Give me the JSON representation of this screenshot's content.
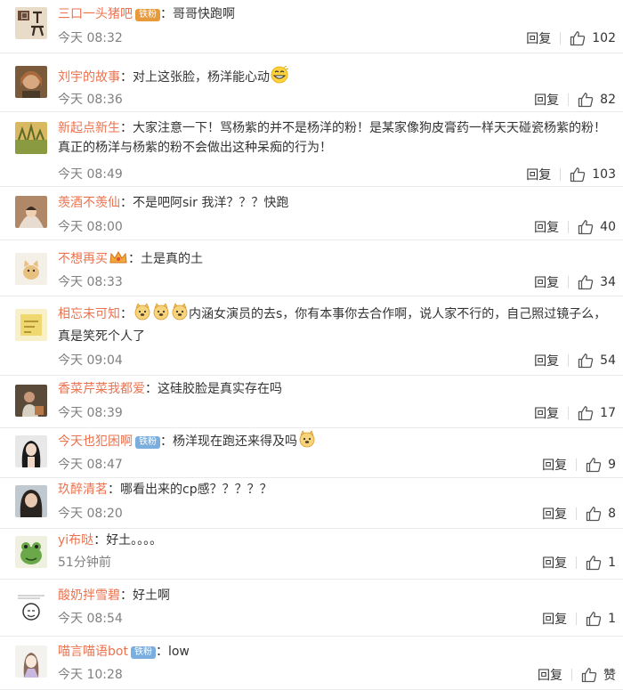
{
  "comments": [
    {
      "username": "三口一头猪吧",
      "badge": {
        "type": "fans",
        "label": "铁粉"
      },
      "text": "哥哥快跑啊",
      "time": "今天 08:32",
      "reply": "回复",
      "likes": "102",
      "avatar": "avatar-calligraphy"
    },
    {
      "username": "刘宇的故事",
      "text": "对上这张脸，杨洋能心动",
      "emojis_after": [
        "grin-emoji"
      ],
      "time": "今天 08:36",
      "reply": "回复",
      "likes": "82",
      "avatar": "avatar-portrait"
    },
    {
      "username": "新起点新生",
      "text": "大家注意一下！骂杨紫的并不是杨洋的粉！是某家像狗皮膏药一样天天碰瓷杨紫的粉！真正的杨洋与杨紫的粉不会做出这种呆痴的行为！",
      "time": "今天 08:49",
      "reply": "回复",
      "likes": "103",
      "avatar": "avatar-field"
    },
    {
      "username": "羡酒不羡仙",
      "text": "不是吧阿sir 我洋？？？快跑",
      "time": "今天 08:00",
      "reply": "回复",
      "likes": "40",
      "avatar": "avatar-blanket"
    },
    {
      "username": "不想再买",
      "badge": {
        "type": "crown"
      },
      "text": "土是真的土",
      "time": "今天 08:33",
      "reply": "回复",
      "likes": "34",
      "avatar": "avatar-cat"
    },
    {
      "username": "相忘未可知",
      "emojis_before": [
        "doge-emoji",
        "doge-emoji",
        "doge-emoji"
      ],
      "text": "内涵女演员的去s，你有本事你去合作啊，说人家不行的，自己照过镜子么，真是笑死个人了",
      "time": "今天 09:04",
      "reply": "回复",
      "likes": "54",
      "avatar": "avatar-yellow"
    },
    {
      "username": "香菜芹菜我都爱",
      "text": "这硅胶脸是真实存在吗",
      "time": "今天 08:39",
      "reply": "回复",
      "likes": "17",
      "avatar": "avatar-person"
    },
    {
      "username": "今天也犯困啊",
      "badge": {
        "type": "iron",
        "label": "铁粉"
      },
      "text": "杨洋现在跑还来得及吗",
      "emojis_after": [
        "doge-emoji"
      ],
      "time": "今天 08:47",
      "reply": "回复",
      "likes": "9",
      "avatar": "avatar-woman"
    },
    {
      "username": "玖醉清茗",
      "text": "哪看出来的cp感？？？？？",
      "time": "今天 08:20",
      "reply": "回复",
      "likes": "8",
      "avatar": "avatar-girl"
    },
    {
      "username": "yi布哒",
      "text": "好土。。。。",
      "time": "51分钟前",
      "reply": "回复",
      "likes": "1",
      "avatar": "avatar-frog"
    },
    {
      "username": "酸奶拌雪碧",
      "text": "好土啊",
      "time": "今天 08:54",
      "reply": "回复",
      "likes": "1",
      "avatar": "avatar-meme"
    },
    {
      "username": "喵言喵语bot",
      "badge": {
        "type": "iron",
        "label": "铁粉"
      },
      "text": "low",
      "time": "今天 10:28",
      "reply": "回复",
      "likes": "赞",
      "avatar": "avatar-drawing"
    }
  ],
  "colors": {
    "username": "#eb7350",
    "text": "#333333",
    "meta": "#808080",
    "divider": "#eaeaea",
    "badge_fans": "#e79a3a",
    "badge_iron": "#7aaedf"
  },
  "icons": {
    "like": "thumbs-up-icon"
  }
}
